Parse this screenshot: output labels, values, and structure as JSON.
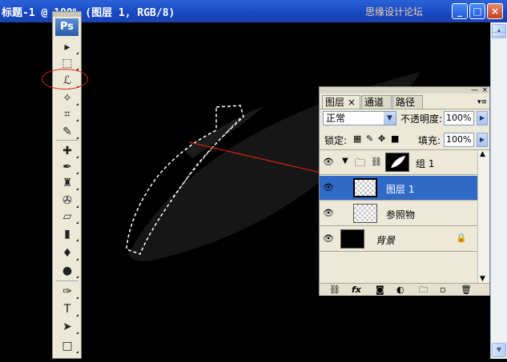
{
  "window": {
    "title": "标题-1 @ 100% (图层 1, RGB/8)",
    "watermark": "思缘设计论坛",
    "minimize": "_",
    "maximize": "□",
    "close": "×"
  },
  "canvas": {
    "background": "#000000"
  },
  "toolbox": {
    "logo": "Ps",
    "tools": [
      {
        "name": "move-tool",
        "glyph": "▸"
      },
      {
        "name": "marquee-tool",
        "glyph": "⬚"
      },
      {
        "name": "lasso-tool",
        "glyph": "ℒ",
        "highlighted": true
      },
      {
        "name": "magic-wand-tool",
        "glyph": "✧"
      },
      {
        "name": "crop-tool",
        "glyph": "⌗"
      },
      {
        "name": "eyedropper-tool",
        "glyph": "✎"
      },
      {
        "name": "healing-brush-tool",
        "glyph": "✚"
      },
      {
        "name": "brush-tool",
        "glyph": "✒"
      },
      {
        "name": "clone-stamp-tool",
        "glyph": "♜"
      },
      {
        "name": "history-brush-tool",
        "glyph": "✇"
      },
      {
        "name": "eraser-tool",
        "glyph": "▱"
      },
      {
        "name": "gradient-tool",
        "glyph": "▮"
      },
      {
        "name": "blur-tool",
        "glyph": "♦"
      },
      {
        "name": "dodge-tool",
        "glyph": "●"
      },
      {
        "name": "pen-tool",
        "glyph": "✑"
      },
      {
        "name": "type-tool",
        "glyph": "T"
      },
      {
        "name": "path-selection-tool",
        "glyph": "➤"
      },
      {
        "name": "shape-tool",
        "glyph": "□"
      }
    ],
    "highlight_color": "#d42211"
  },
  "layers_panel": {
    "tabs": [
      "图层",
      "通道",
      "路径"
    ],
    "tab_close": "×",
    "menu": "▾≡",
    "blend_mode": "正常",
    "opacity_label": "不透明度:",
    "opacity_value": "100%",
    "lock_label": "锁定:",
    "fill_label": "填充:",
    "fill_value": "100%",
    "layers": [
      {
        "name": "组 1",
        "type": "group",
        "visible": true,
        "selected": false
      },
      {
        "name": "图层 1",
        "type": "layer",
        "visible": true,
        "selected": true
      },
      {
        "name": "参照物",
        "type": "layer",
        "visible": true,
        "selected": false
      },
      {
        "name": "背景",
        "type": "background",
        "visible": true,
        "selected": false,
        "locked": true
      }
    ],
    "bottom_icons": [
      "link-icon",
      "fx-icon",
      "mask-icon",
      "adjustment-icon",
      "folder-icon",
      "new-layer-icon",
      "trash-icon"
    ],
    "selected_color": "#3169c6"
  }
}
